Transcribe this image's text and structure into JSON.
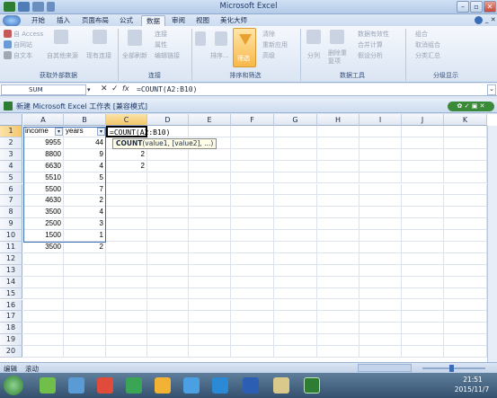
{
  "window": {
    "title": "Microsoft Excel"
  },
  "tabs": [
    "开始",
    "插入",
    "页面布局",
    "公式",
    "数据",
    "审阅",
    "视图",
    "美化大师"
  ],
  "ribbon": {
    "access": "自 Access",
    "web": "自网站",
    "text": "自文本",
    "other_sources": "自其他来源",
    "existing_connections": "现有连接",
    "refresh_all": "全部刷新",
    "connections": "连接",
    "properties": "属性",
    "edit_links": "编辑链接",
    "sort": "排序...",
    "filter": "筛选",
    "clear": "清除",
    "reapply": "重新应用",
    "advanced": "高级",
    "text_to_columns": "分列",
    "remove_duplicates": "删除重复项",
    "data_validation": "数据有效性",
    "consolidate": "合并计算",
    "what_if": "假设分析",
    "group": "组合",
    "ungroup": "取消组合",
    "subtotal": "分类汇总",
    "group_labels": [
      "获取外部数据",
      "连接",
      "排序和筛选",
      "数据工具",
      "分级显示"
    ]
  },
  "formula_bar": {
    "name_box": "SUM",
    "formula": "=COUNT(A2:B10)",
    "cancel": "✕",
    "enter": "✓",
    "fx": "fx"
  },
  "workbook": {
    "title": "新建 Microsoft Excel 工作表 [兼容模式]"
  },
  "sheet": {
    "columns": [
      "A",
      "B",
      "C",
      "D",
      "E",
      "F",
      "G",
      "H",
      "I",
      "J",
      "K"
    ],
    "rows": [
      "1",
      "2",
      "3",
      "4",
      "5",
      "6",
      "7",
      "8",
      "9",
      "10",
      "11",
      "12",
      "13",
      "14",
      "15",
      "16",
      "17",
      "18",
      "19",
      "20"
    ],
    "header_a": "income",
    "header_b": "years",
    "income": [
      "9955",
      "8800",
      "6630",
      "5510",
      "5500",
      "4630",
      "3500",
      "2500",
      "1500",
      "3500"
    ],
    "years": [
      "44",
      "9",
      "4",
      "5",
      "7",
      "2",
      "4",
      "3",
      "1",
      "2"
    ],
    "c_values": [
      "",
      "2",
      "2"
    ],
    "editing_cell_text": "=COUNT(A2:B10)",
    "tooltip": "COUNT(value1, [value2], ...)"
  },
  "status": {
    "mode": "编辑",
    "scroll": "滚动"
  },
  "taskbar": {
    "time": "21:51",
    "date": "2015/11/7"
  },
  "colors": {
    "accent": "#3a6db5",
    "tab_active": "#f2f6fc",
    "taskbar": "#34516f"
  }
}
